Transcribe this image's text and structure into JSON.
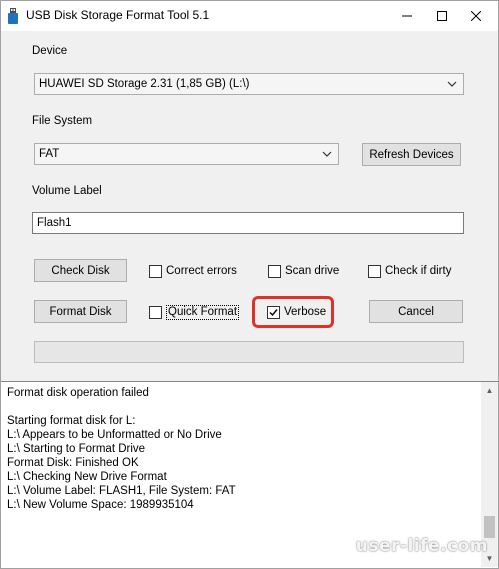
{
  "window": {
    "title": "USB Disk Storage Format Tool 5.1",
    "controls": {
      "minimize": "—",
      "maximize": "☐",
      "close": "✕"
    }
  },
  "device": {
    "label": "Device",
    "selected": "HUAWEI  SD Storage  2.31 (1,85 GB) (L:\\)"
  },
  "file_system": {
    "label": "File System",
    "selected": "FAT",
    "refresh_label": "Refresh Devices"
  },
  "volume_label": {
    "label": "Volume Label",
    "value": "Flash1"
  },
  "actions": {
    "check_disk": "Check Disk",
    "format_disk": "Format Disk",
    "cancel": "Cancel"
  },
  "options": {
    "correct_errors": {
      "label": "Correct errors",
      "checked": false
    },
    "scan_drive": {
      "label": "Scan drive",
      "checked": false
    },
    "check_if_dirty": {
      "label": "Check if dirty",
      "checked": false
    },
    "quick_format": {
      "label": "Quick Format",
      "checked": false
    },
    "verbose": {
      "label": "Verbose",
      "checked": true
    }
  },
  "progress": {
    "value": 0
  },
  "log": {
    "lines": [
      "Format disk operation failed",
      "",
      "Starting format disk for L:",
      "L:\\ Appears to be Unformatted or No Drive",
      "L:\\ Starting to Format Drive",
      "Format Disk: Finished OK",
      "L:\\ Checking New Drive Format",
      "L:\\ Volume Label: FLASH1, File System: FAT",
      "L:\\ New Volume Space: 1989935104"
    ]
  },
  "watermark": "user-life.com",
  "colors": {
    "highlight": "#e0302a",
    "background": "#f0f0f0"
  }
}
